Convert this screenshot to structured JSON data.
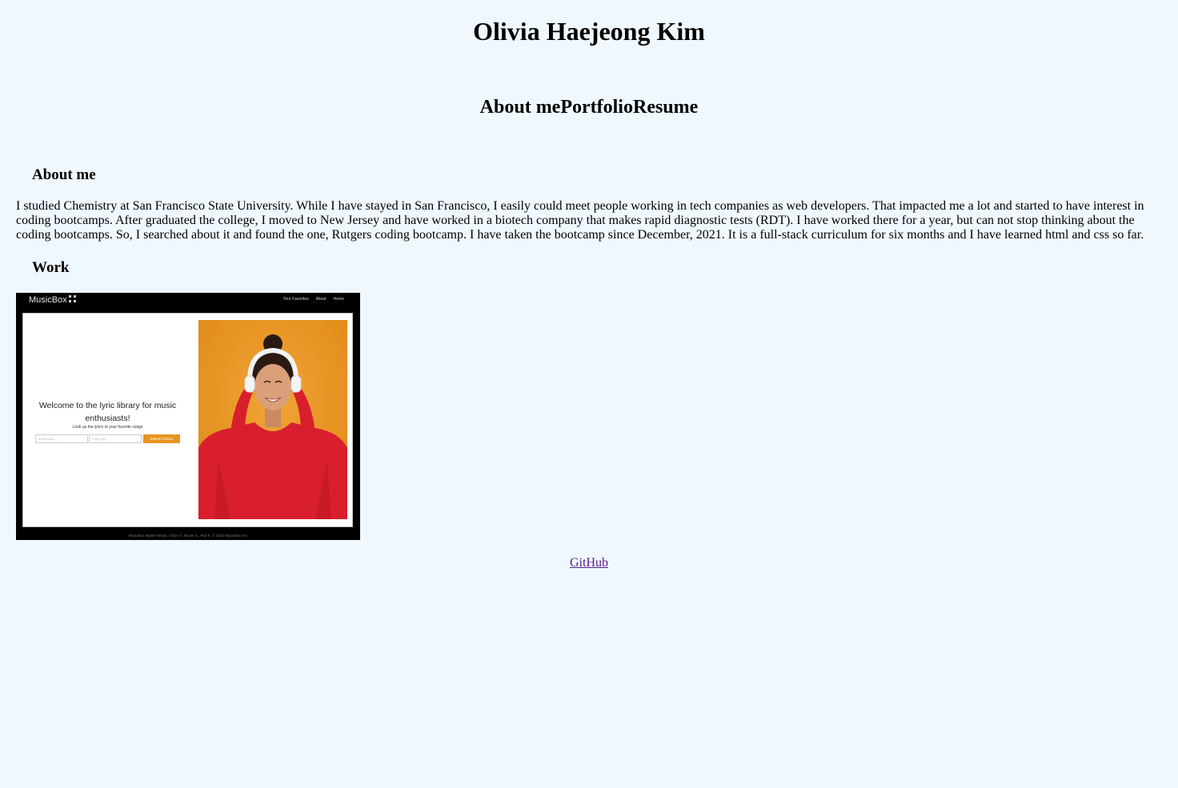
{
  "header": {
    "title": "Olivia Haejeong Kim"
  },
  "nav": {
    "items": [
      {
        "label": "About me"
      },
      {
        "label": "Portfolio"
      },
      {
        "label": "Resume"
      }
    ]
  },
  "about": {
    "heading": "About me",
    "text": "I studied Chemistry at San Francisco State University. While I have stayed in San Francisco, I easily could meet people working in tech companies as web developers. That impacted me a lot and started to have interest in coding bootcamps. After graduated the college, I moved to New Jersey and have worked in a biotech company that makes rapid diagnostic tests (RDT). I have worked there for a year, but can not stop thinking about the coding bootcamps. So, I searched about it and found the one, Rutgers coding bootcamp. I have taken the bootcamp since December, 2021. It is a full-stack curriculum for six months and I have learned html and css so far."
  },
  "work": {
    "heading": "Work",
    "project": {
      "brand": "MusicBox",
      "nav_items": [
        "Your Favorites",
        "About",
        "Home"
      ],
      "welcome": "Welcome to the lyric library for music enthusiasts!",
      "subtext": "Look up the lyrics to your favorite songs",
      "artist_placeholder": "Artist name...",
      "song_placeholder": "Song title...",
      "search_label": "Search Library",
      "footer": "MusicBox Master Minds: Chloe T., Nicole S., Pua K. © 2022 MusicBox, Inc",
      "colors": {
        "accent": "#e89422",
        "photo_background": "#e8951f",
        "sweater": "#d91f2e"
      }
    }
  },
  "footer": {
    "github_label": "GitHub"
  }
}
